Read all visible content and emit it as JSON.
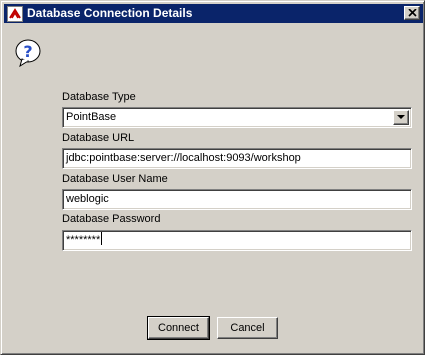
{
  "window": {
    "title": "Database Connection Details"
  },
  "icons": {
    "app": "app-icon",
    "close": "close-icon",
    "dialog": "question-icon",
    "dropdown": "chevron-down-icon"
  },
  "form": {
    "db_type_label": "Database Type",
    "db_type_value": "PointBase",
    "db_url_label": "Database URL",
    "db_url_value": "jdbc:pointbase:server://localhost:9093/workshop",
    "db_user_label": "Database User Name",
    "db_user_value": "weblogic",
    "db_password_label": "Database Password",
    "db_password_value": "********"
  },
  "buttons": {
    "connect": "Connect",
    "cancel": "Cancel"
  },
  "colors": {
    "titlebar": "#0a246a",
    "window_bg": "#d4d0c8",
    "question_icon": "#2a50c8"
  }
}
